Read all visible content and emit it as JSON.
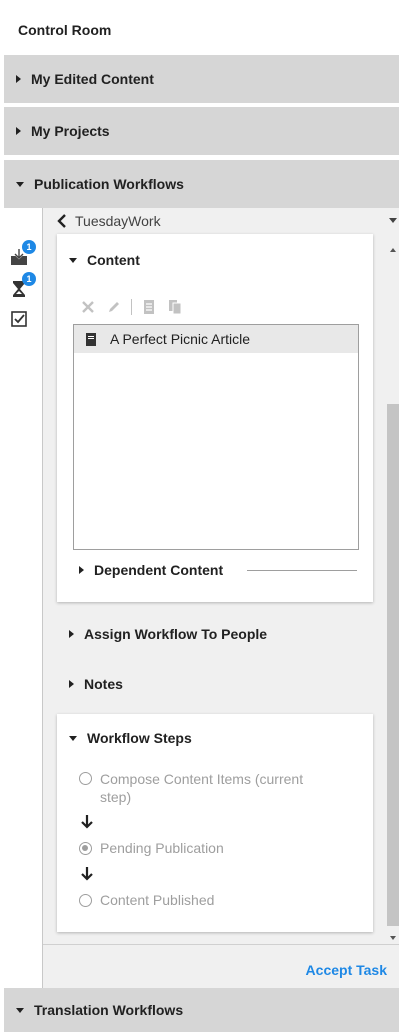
{
  "app": {
    "title": "Control Room"
  },
  "sections": {
    "my_edited_content": "My Edited Content",
    "my_projects": "My Projects",
    "publication_workflows": "Publication Workflows",
    "translation_workflows": "Translation Workflows"
  },
  "tabs": {
    "inbox_badge": "1",
    "pending_badge": "1"
  },
  "workflow": {
    "name": "TuesdayWork"
  },
  "content": {
    "header": "Content",
    "items": [
      {
        "label": "A Perfect Picnic Article",
        "icon": "document-icon"
      }
    ],
    "dependent_header": "Dependent Content"
  },
  "assign": {
    "label": "Assign Workflow To People"
  },
  "notes": {
    "label": "Notes"
  },
  "steps": {
    "header": "Workflow Steps",
    "items": [
      {
        "label_line1": "Compose Content Items (current",
        "label_line2": "step)",
        "selected": false
      },
      {
        "label": "Pending Publication",
        "selected": true
      },
      {
        "label": "Content Published",
        "selected": false
      }
    ]
  },
  "actions": {
    "accept": "Accept Task"
  },
  "colors": {
    "accent": "#1e88e5",
    "section_bg": "#d6d6d6",
    "content_bg": "#f0f0f0"
  }
}
